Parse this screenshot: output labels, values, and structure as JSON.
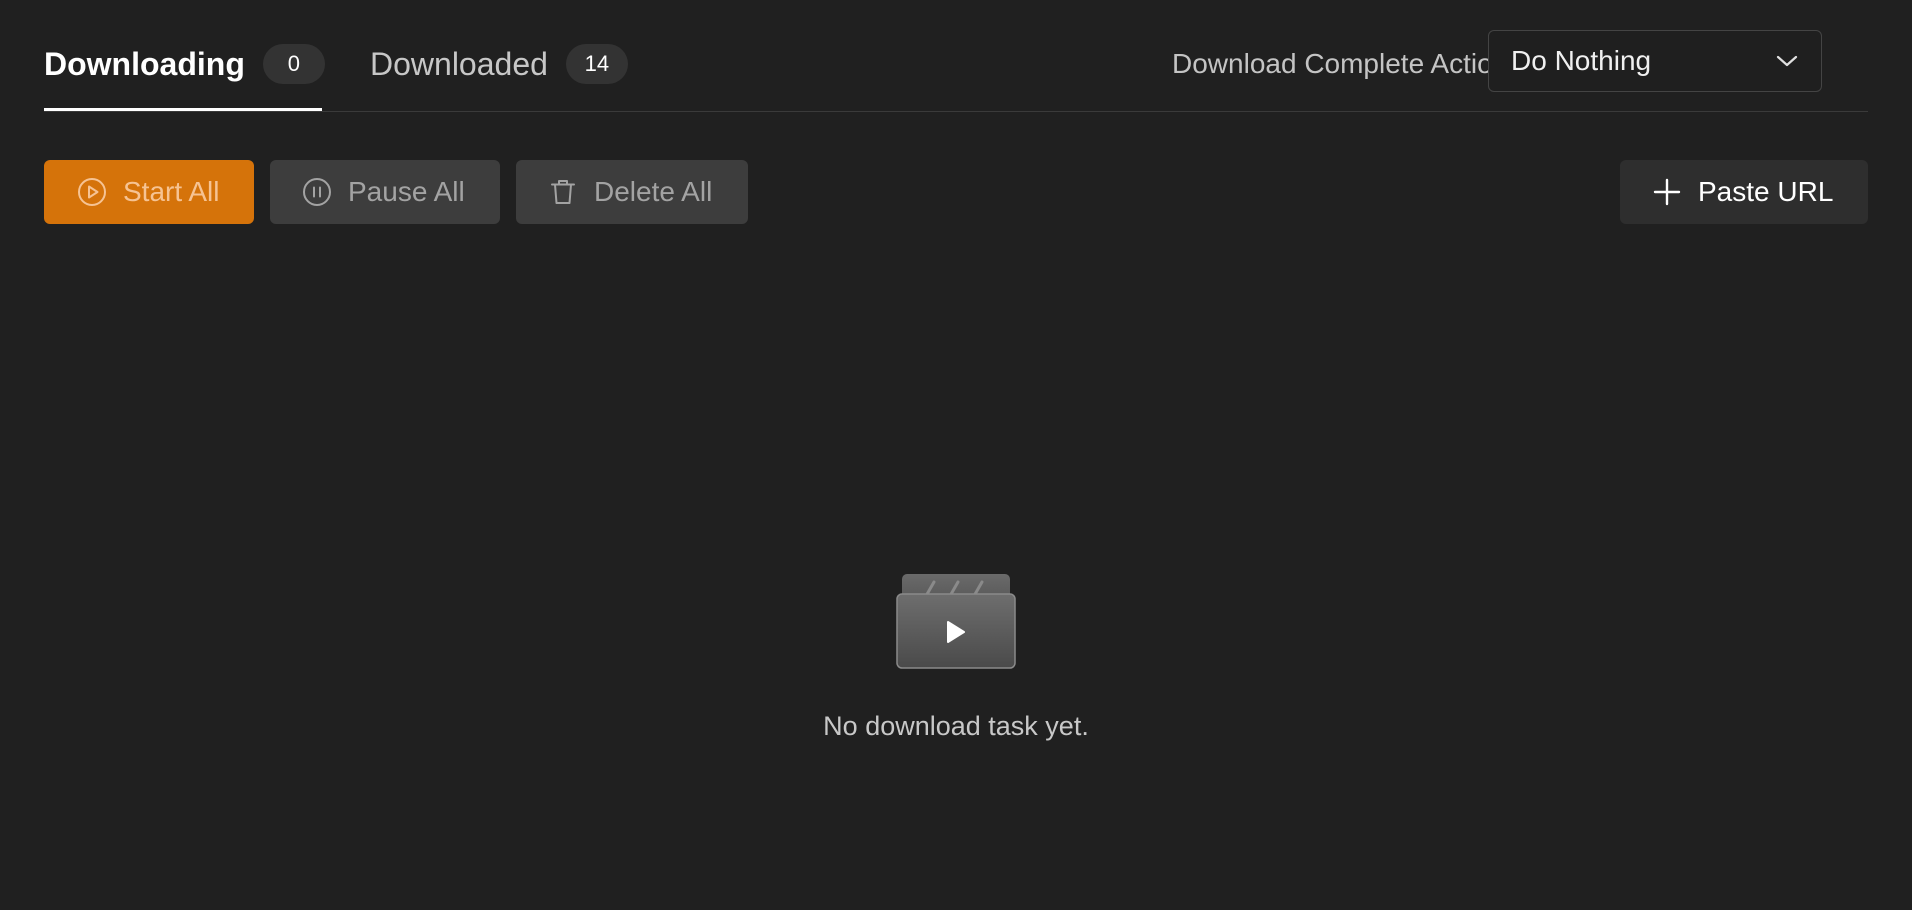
{
  "tabs": {
    "downloading": {
      "label": "Downloading",
      "count": "0"
    },
    "downloaded": {
      "label": "Downloaded",
      "count": "14"
    }
  },
  "complete_action": {
    "label": "Download Complete Action:",
    "value": "Do Nothing"
  },
  "toolbar": {
    "start_all": "Start All",
    "pause_all": "Pause All",
    "delete_all": "Delete All",
    "paste_url": "Paste URL"
  },
  "empty_state": {
    "message": "No download task yet.",
    "icon": "video-clapper-icon"
  },
  "colors": {
    "background": "#202020",
    "accent": "#d5730a",
    "button_secondary": "#3d3d3d"
  }
}
